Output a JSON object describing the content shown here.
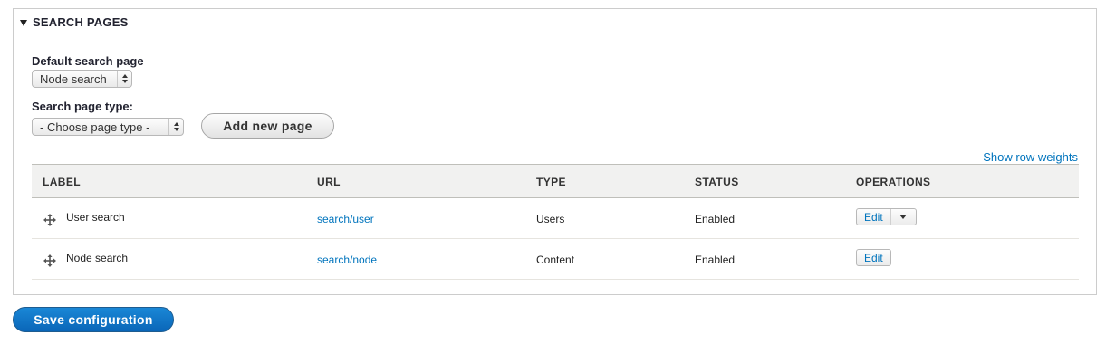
{
  "fieldset": {
    "legend": "SEARCH PAGES"
  },
  "default_search": {
    "label": "Default search page",
    "value": "Node search"
  },
  "page_type": {
    "label": "Search page type:",
    "value": "- Choose page type -"
  },
  "add_button": "Add new page",
  "show_weights": "Show row weights",
  "table": {
    "headers": [
      "LABEL",
      "URL",
      "TYPE",
      "STATUS",
      "OPERATIONS"
    ],
    "rows": [
      {
        "label": "User search",
        "url": "search/user",
        "type": "Users",
        "status": "Enabled",
        "operation": "Edit"
      },
      {
        "label": "Node search",
        "url": "search/node",
        "type": "Content",
        "status": "Enabled",
        "operation": "Edit"
      }
    ]
  },
  "save_button": "Save configuration",
  "colors": {
    "link": "#0074bd",
    "primary": "#0a66b8"
  }
}
